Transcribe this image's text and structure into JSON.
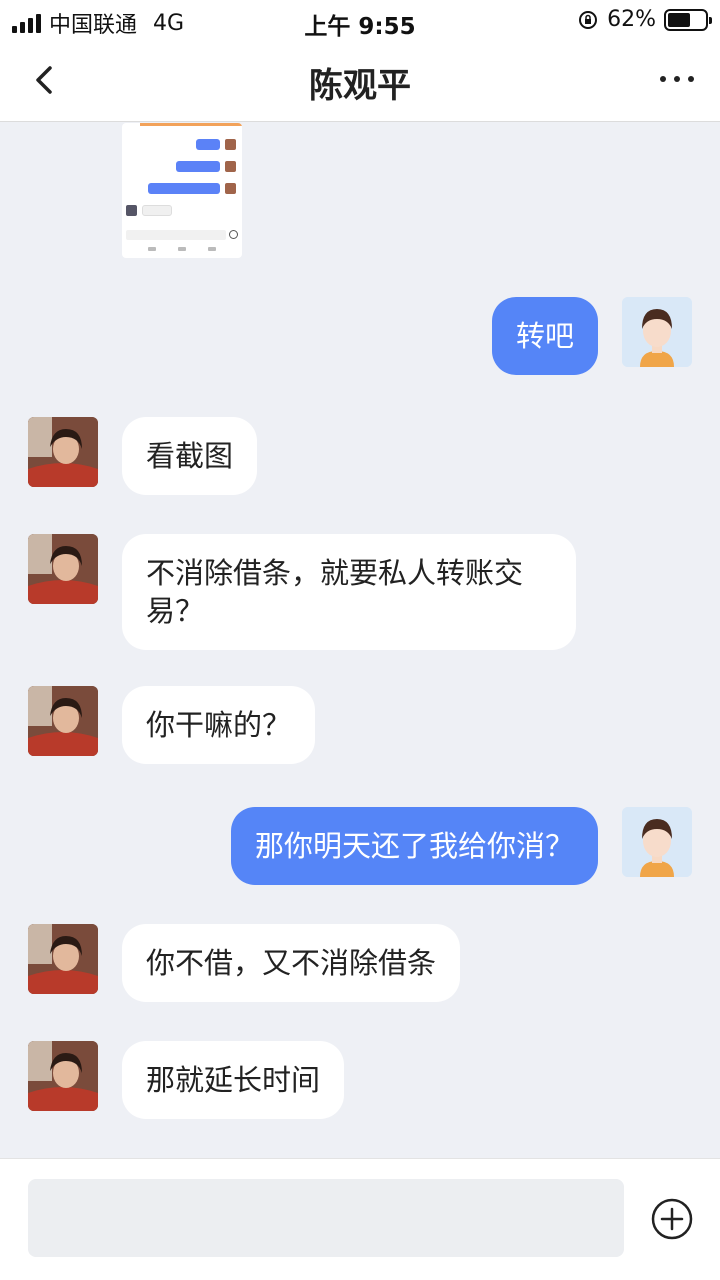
{
  "status_bar": {
    "carrier": "中国联通",
    "network": "4G",
    "time": "上午 9:55",
    "battery_percent": "62%",
    "battery_level": 0.62
  },
  "nav": {
    "title": "陈观平",
    "back_icon": "chevron-left-icon",
    "more_icon": "more-dots-icon"
  },
  "messages": [
    {
      "side": "out",
      "text": "转吧"
    },
    {
      "side": "in",
      "text": "看截图"
    },
    {
      "side": "in",
      "text": "不消除借条，就要私人转账交易？"
    },
    {
      "side": "in",
      "text": "你干嘛的？"
    },
    {
      "side": "out",
      "text": "那你明天还了我给你消？"
    },
    {
      "side": "in",
      "text": "你不借，又不消除借条"
    },
    {
      "side": "in",
      "text": "那就延长时间"
    }
  ],
  "input": {
    "placeholder": "",
    "plus_icon": "plus-circle-icon"
  },
  "colors": {
    "outgoing_bubble": "#5585f7",
    "incoming_bubble": "#ffffff",
    "chat_background": "#eef0f5"
  }
}
